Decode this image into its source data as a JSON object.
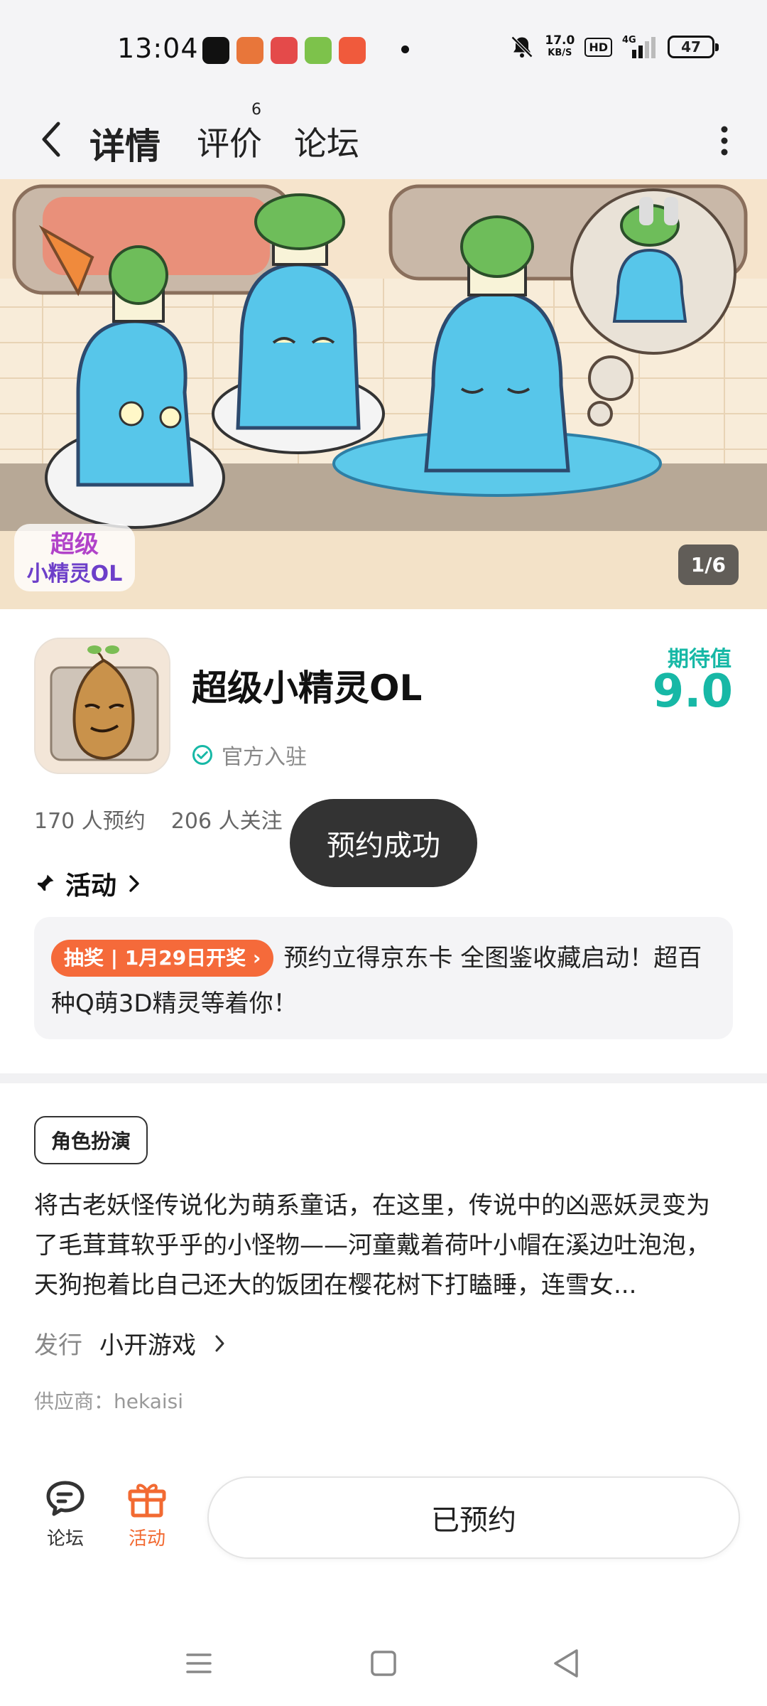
{
  "status_bar": {
    "time": "13:04",
    "net_speed_value": "17.0",
    "net_speed_unit": "KB/S",
    "hd_label": "HD",
    "network": "4G",
    "battery": "47"
  },
  "nav": {
    "tabs": [
      {
        "label": "详情",
        "active": true
      },
      {
        "label": "评价",
        "badge": "6"
      },
      {
        "label": "论坛"
      }
    ]
  },
  "hero": {
    "counter": "1/6",
    "logo_text": "超级小精灵OL"
  },
  "app": {
    "name": "超级小精灵OL",
    "official_label": "官方入驻",
    "rating_label": "期待值",
    "rating_value": "9.0",
    "reservations": "170 人预约",
    "followers": "206 人关注"
  },
  "toast": "预约成功",
  "activity": {
    "heading": "活动",
    "tag": "抽奖 | 1月29日开奖",
    "text": "预约立得京东卡 全图鉴收藏启动！超百种Q萌3D精灵等着你！"
  },
  "details": {
    "genre": "角色扮演",
    "description": "将古老妖怪传说化为萌系童话，在这里，传说中的凶恶妖灵变为了毛茸茸软乎乎的小怪物——河童戴着荷叶小帽在溪边吐泡泡，天狗抱着比自己还大的饭团在樱花树下打瞌睡，连雪女...",
    "publisher_label": "发行",
    "publisher": "小开游戏",
    "supplier": "供应商：hekaisi"
  },
  "bottom_bar": {
    "forum_label": "论坛",
    "activity_label": "活动",
    "main_button": "已预约"
  },
  "colors": {
    "accent_teal": "#17b8a6",
    "tab_highlight": "#22d3b8",
    "activity_orange": "#f26a32",
    "lottery_tag": "#f56a3a"
  }
}
